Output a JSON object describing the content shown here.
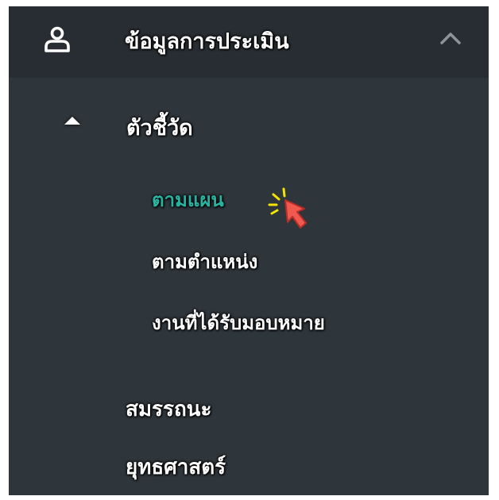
{
  "menu": {
    "header": {
      "label": "ข้อมูลการประเมิน",
      "icon": "user-icon",
      "toggle_icon": "chevron-up-icon",
      "expanded": true
    },
    "section": {
      "label": "ตัวชี้วัด",
      "icon": "triangle-up-icon",
      "expanded": true,
      "items": [
        {
          "label": "ตามแผน",
          "active": true
        },
        {
          "label": "ตามตำแหน่ง",
          "active": false
        },
        {
          "label": "งานที่ได้รับมอบหมาย",
          "active": false
        }
      ]
    },
    "items": [
      {
        "label": "สมรรถนะ"
      },
      {
        "label": "ยุทธศาสตร์"
      }
    ]
  },
  "colors": {
    "panel_bg": "#2e353b",
    "header_bg": "#272d32",
    "text": "#ffffff",
    "active_text": "#28b3a2",
    "cursor": "#f0594e",
    "click_sparks": "#f5e300"
  },
  "cursor": {
    "icon": "hand-pointer-click-icon"
  }
}
